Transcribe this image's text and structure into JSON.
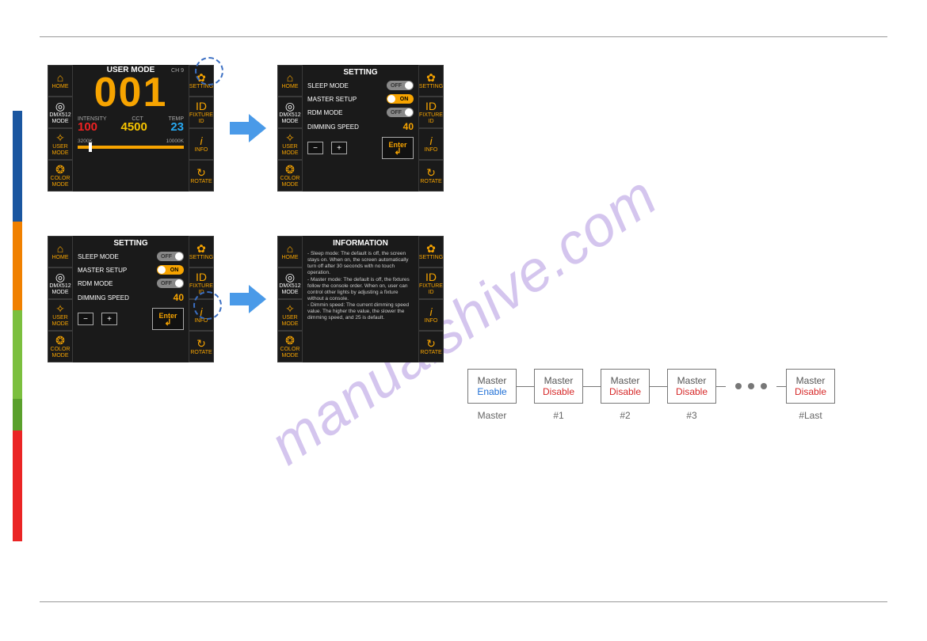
{
  "watermark": "manualshive.com",
  "side_buttons": {
    "home": "HOME",
    "dmx": "DMX512 MODE",
    "user": "USER MODE",
    "color": "COLOR MODE",
    "setting": "SETTING",
    "fixture": "FIXTURE ID",
    "info": "INFO",
    "rotate": "ROTATE"
  },
  "panel1": {
    "title": "USER MODE",
    "ch_label": "CH   9",
    "big": "001",
    "labels": {
      "intensity": "INTENSITY",
      "cct": "CCT",
      "temp": "TEMP"
    },
    "values": {
      "intensity": "100",
      "cct": "4500",
      "temp": "23"
    },
    "slider": {
      "left": "3200K",
      "right": "10000K"
    }
  },
  "setting_panel": {
    "title": "SETTING",
    "rows": {
      "sleep": {
        "label": "SLEEP MODE",
        "state": "OFF"
      },
      "master": {
        "label": "MASTER SETUP",
        "state": "ON"
      },
      "rdm": {
        "label": "RDM MODE",
        "state": "OFF"
      },
      "dim": {
        "label": "DIMMING SPEED",
        "value": "40"
      }
    },
    "buttons": {
      "minus": "−",
      "plus": "+",
      "enter": "Enter"
    }
  },
  "info_panel": {
    "title": "INFORMATION",
    "text": "- Sleep mode: The default is off, the screen stays on. When on, the screen automatically turn off after 30 seconds with no touch operation.\n- Master mode: The default is off, the fixtures follow the console order. When on, user can control other lights by adjusting a fixture without a console.\n- Dimmin speed: The current dimming speed value. The higher the value, the slower the dimming speed, and 25 is default."
  },
  "chain": {
    "word": "Master",
    "enable": "Enable",
    "disable": "Disable",
    "labels": [
      "Master",
      "#1",
      "#2",
      "#3",
      "#Last"
    ]
  }
}
